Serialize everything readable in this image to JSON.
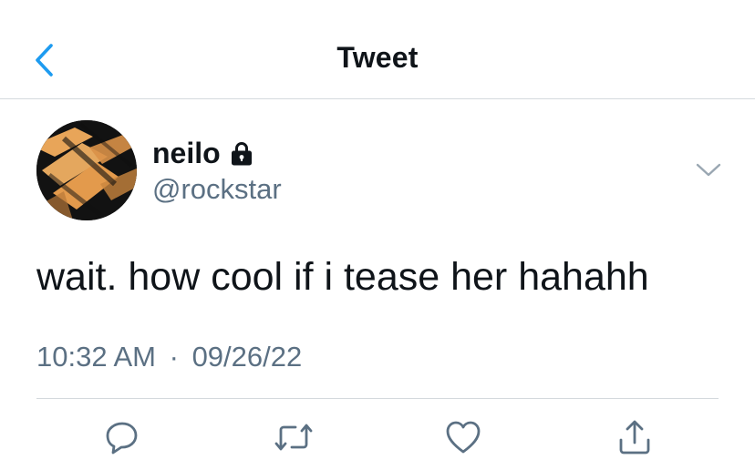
{
  "header": {
    "title": "Tweet",
    "back_icon": "chevron-left-icon",
    "accent_color": "#1d9bf0"
  },
  "author": {
    "name": "neilo",
    "handle": "@rockstar",
    "protected_icon": "lock-icon",
    "avatar_icon": "avatar-image"
  },
  "tweet": {
    "text": "wait. how cool if i tease her hahahh",
    "time": "10:32 AM",
    "separator": "·",
    "date": "09/26/22"
  },
  "actions": {
    "reply_icon": "reply-icon",
    "retweet_icon": "retweet-icon",
    "like_icon": "heart-icon",
    "share_icon": "share-icon"
  },
  "colors": {
    "text": "#0f1419",
    "secondary": "#5b7083",
    "divider": "#d4d9dd",
    "icon": "#5b7083"
  }
}
